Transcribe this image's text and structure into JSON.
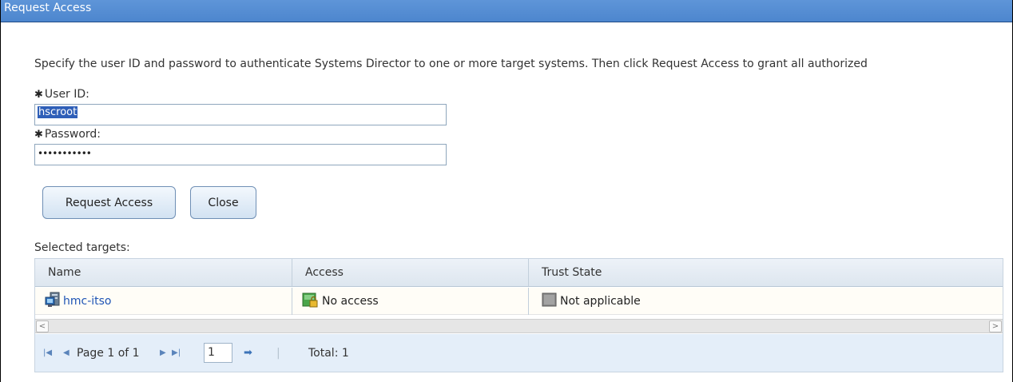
{
  "window": {
    "title": "Request Access"
  },
  "instructions": "Specify the user ID and password to authenticate Systems Director to one or more target systems. Then click Request Access to grant all authorized",
  "form": {
    "required_marker": "✱",
    "user_id_label": "User ID:",
    "user_id_value": "hscroot",
    "password_label": "Password:",
    "password_masked": "•••••••••••"
  },
  "buttons": {
    "request_access": "Request Access",
    "close": "Close"
  },
  "targets": {
    "label": "Selected targets:",
    "columns": [
      "Name",
      "Access",
      "Trust State"
    ],
    "rows": [
      {
        "name": "hmc-itso",
        "name_icon": "managed-system-icon",
        "access": "No access",
        "access_icon": "locked-access-icon",
        "trust_state": "Not applicable",
        "trust_icon": "trust-state-icon"
      }
    ]
  },
  "pager": {
    "page_text": "Page 1 of 1",
    "page_input": "1",
    "total": "Total: 1"
  },
  "colors": {
    "titlebar": "#4d86ce",
    "link": "#1f54b5",
    "pager_bg": "#e4eef9"
  }
}
